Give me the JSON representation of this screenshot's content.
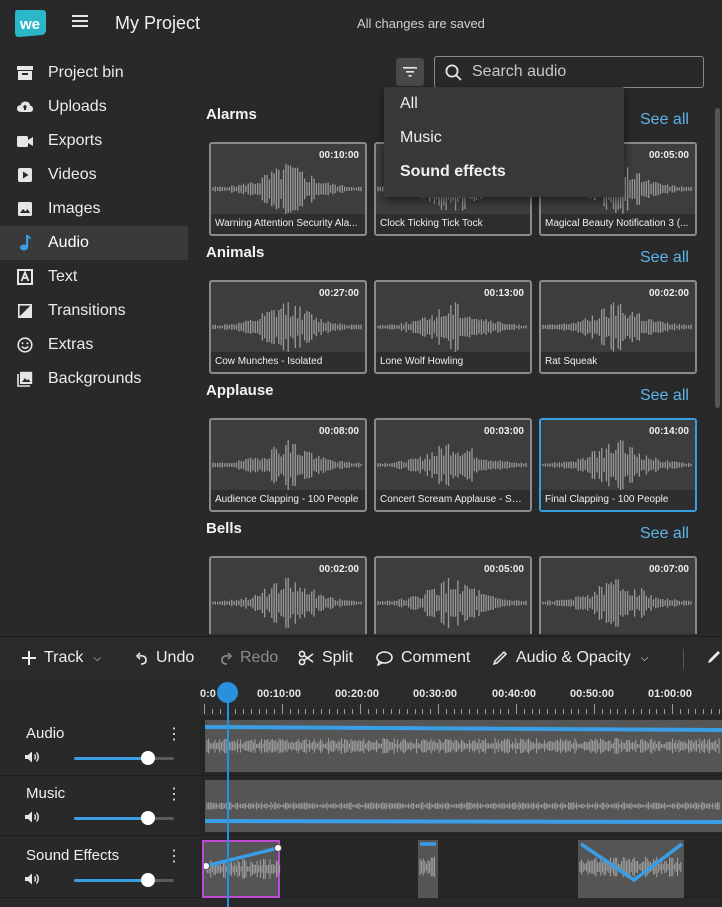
{
  "app": {
    "logo_text": "we",
    "project_title": "My Project",
    "save_status": "All changes are saved"
  },
  "sidebar": {
    "items": [
      {
        "label": "Project bin",
        "icon": "folder-icon"
      },
      {
        "label": "Uploads",
        "icon": "cloud-upload-icon"
      },
      {
        "label": "Exports",
        "icon": "camera-icon"
      },
      {
        "label": "Videos",
        "icon": "play-icon"
      },
      {
        "label": "Images",
        "icon": "image-icon"
      },
      {
        "label": "Audio",
        "icon": "music-note-icon",
        "active": true
      },
      {
        "label": "Text",
        "icon": "text-icon"
      },
      {
        "label": "Transitions",
        "icon": "transition-icon"
      },
      {
        "label": "Extras",
        "icon": "smiley-icon"
      },
      {
        "label": "Backgrounds",
        "icon": "background-icon"
      }
    ]
  },
  "search": {
    "placeholder": "Search audio"
  },
  "filter_menu": {
    "items": [
      "All",
      "Music",
      "Sound effects"
    ]
  },
  "see_all_label": "See all",
  "categories": [
    {
      "title": "Alarms",
      "items": [
        {
          "duration": "00:10:00",
          "name": "Warning Attention Security Ala..."
        },
        {
          "duration": "",
          "name": "Clock Ticking Tick Tock"
        },
        {
          "duration": "00:05:00",
          "name": "Magical Beauty Notification 3 (..."
        }
      ]
    },
    {
      "title": "Animals",
      "items": [
        {
          "duration": "00:27:00",
          "name": "Cow Munches - Isolated"
        },
        {
          "duration": "00:13:00",
          "name": "Lone Wolf Howling"
        },
        {
          "duration": "00:02:00",
          "name": "Rat Squeak"
        }
      ]
    },
    {
      "title": "Applause",
      "items": [
        {
          "duration": "00:08:00",
          "name": "Audience Clapping - 100 People"
        },
        {
          "duration": "00:03:00",
          "name": "Concert Scream Applause - Sho..."
        },
        {
          "duration": "00:14:00",
          "name": "Final Clapping - 100 People",
          "selected": true
        }
      ]
    },
    {
      "title": "Bells",
      "items": [
        {
          "duration": "00:02:00",
          "name": ""
        },
        {
          "duration": "00:05:00",
          "name": ""
        },
        {
          "duration": "00:07:00",
          "name": ""
        }
      ]
    }
  ],
  "toolbar": {
    "track_label": "Track",
    "undo_label": "Undo",
    "redo_label": "Redo",
    "split_label": "Split",
    "comment_label": "Comment",
    "audio_opacity_label": "Audio & Opacity"
  },
  "timeline": {
    "ruler_labels": [
      "0:0",
      "00:10:00",
      "00:20:00",
      "00:30:00",
      "00:40:00",
      "00:50:00",
      "01:00:00"
    ],
    "tracks": [
      {
        "name": "Audio",
        "volume": 0.74
      },
      {
        "name": "Music",
        "volume": 0.74
      },
      {
        "name": "Sound Effects",
        "volume": 0.74
      }
    ]
  },
  "colors": {
    "accent": "#3a9ee6",
    "link": "#5db4e8",
    "selected_clip": "#c04ad8",
    "logo": "#2ab7c9"
  }
}
